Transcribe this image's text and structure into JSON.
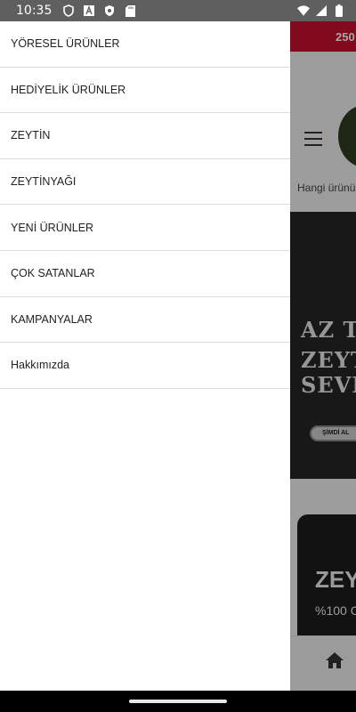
{
  "status_bar": {
    "time": "10:35",
    "left_icons": [
      "shield-icon",
      "a-app-icon",
      "shield-check-icon",
      "sd-card-icon"
    ],
    "right_icons": [
      "wifi-icon",
      "signal-icon",
      "battery-icon"
    ]
  },
  "background_page": {
    "promo_text": "250",
    "search_placeholder": "Hangi ürünü",
    "banner": {
      "line1": "AZ T",
      "line2": "ZEYT",
      "line3": "SEVE",
      "button_label": "ŞİMDİ AL"
    },
    "card": {
      "title": "ZEY",
      "subtitle": "%100 C"
    }
  },
  "drawer": {
    "items": [
      {
        "label": "YÖRESEL ÜRÜNLER"
      },
      {
        "label": "HEDİYELİK ÜRÜNLER"
      },
      {
        "label": "ZEYTİN"
      },
      {
        "label": "ZEYTİNYAĞI"
      },
      {
        "label": "YENİ ÜRÜNLER"
      },
      {
        "label": "ÇOK SATANLAR"
      },
      {
        "label": "KAMPANYALAR"
      },
      {
        "label": "Hakkımızda"
      }
    ]
  },
  "colors": {
    "promo_bar": "#c8102e",
    "status_bar": "#5f5f5f",
    "banner_bg": "#252525"
  }
}
